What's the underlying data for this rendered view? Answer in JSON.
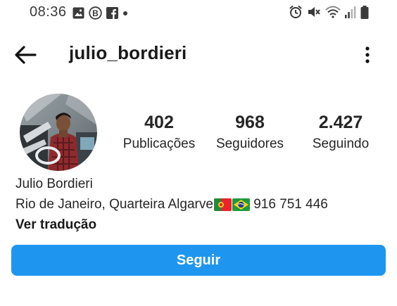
{
  "status_bar": {
    "time": "08:36",
    "left_icons": [
      "image-icon",
      "b-badge-icon",
      "facebook-icon",
      "dot-icon"
    ],
    "right_icons": [
      "alarm-icon",
      "mute-icon",
      "wifi-icon",
      "signal-icon",
      "battery-icon"
    ]
  },
  "header": {
    "username": "julio_bordieri",
    "back_icon": "back-arrow-icon",
    "more_icon": "more-vertical-icon"
  },
  "profile": {
    "stats": {
      "posts_value": "402",
      "posts_label": "Publicações",
      "followers_value": "968",
      "followers_label": "Seguidores",
      "following_value": "2.427",
      "following_label": "Seguindo"
    },
    "bio": {
      "name": "Julio Bordieri",
      "location_text": "Rio de Janeiro, Quarteira Algarve",
      "phone_text": " 916 751 446",
      "translate_label": "Ver tradução"
    }
  },
  "follow_button": {
    "label": "Seguir"
  },
  "colors": {
    "primary": "#1e96f0",
    "text": "#262626",
    "background": "#ffffff"
  }
}
